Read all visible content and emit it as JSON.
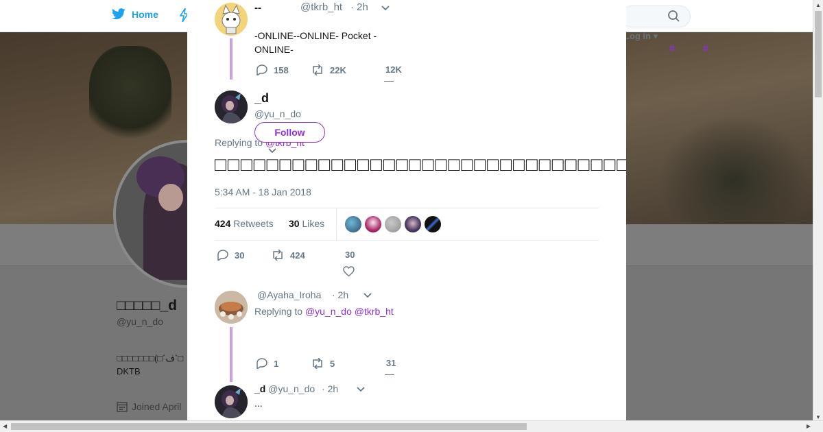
{
  "background": {
    "nav": {
      "home_label": "Home",
      "login_label": "Log in",
      "hashtag_1": "#",
      "hashtag_2": "#"
    },
    "profile": {
      "display_name": "□□□□□_d",
      "handle": "@yu_n_do",
      "bio_line_1": "□□□□□□□(□´ف`□",
      "bio_line_2": "DKTB",
      "joined": "Joined April"
    }
  },
  "modal": {
    "parent_tweet": {
      "name": "--",
      "handle": "@tkrb_ht",
      "time": "· 2h",
      "text": "-ONLINE--ONLINE- Pocket -ONLINE-",
      "replies": "158",
      "retweets": "22K",
      "likes": "12K"
    },
    "main_tweet": {
      "name": "_d",
      "handle": "@yu_n_do",
      "follow_label": "Follow",
      "replying_prefix": "Replying to",
      "replying_to": "@tkrb_ht",
      "text": "□□□□□□□□□□□□□□□□□□□□□□□□□□□□□□□□□□□□□□□□□□□□□□□□□□□□□□□□·□□□□□□□□□",
      "timestamp": "5:34 AM - 18 Jan 2018",
      "retweets_count": "424",
      "retweets_label": "Retweets",
      "likes_count": "30",
      "likes_label": "Likes",
      "replies": "30",
      "retweets": "424",
      "likes": "30"
    },
    "reply_tweet": {
      "handle": "@Ayaha_Iroha",
      "time": "· 2h",
      "replying_prefix": "Replying to",
      "replying_to": "@yu_n_do @tkrb_ht",
      "replies": "1",
      "retweets": "5",
      "likes": "31"
    },
    "last_tweet": {
      "name": "_d",
      "handle": "@yu_n_do",
      "time": "· 2h",
      "text": "..."
    }
  },
  "colors": {
    "accent": "#8e2ed9",
    "twitter_blue": "#1da1f2",
    "muted": "#657786",
    "thread_line": "#c9a0e6"
  }
}
